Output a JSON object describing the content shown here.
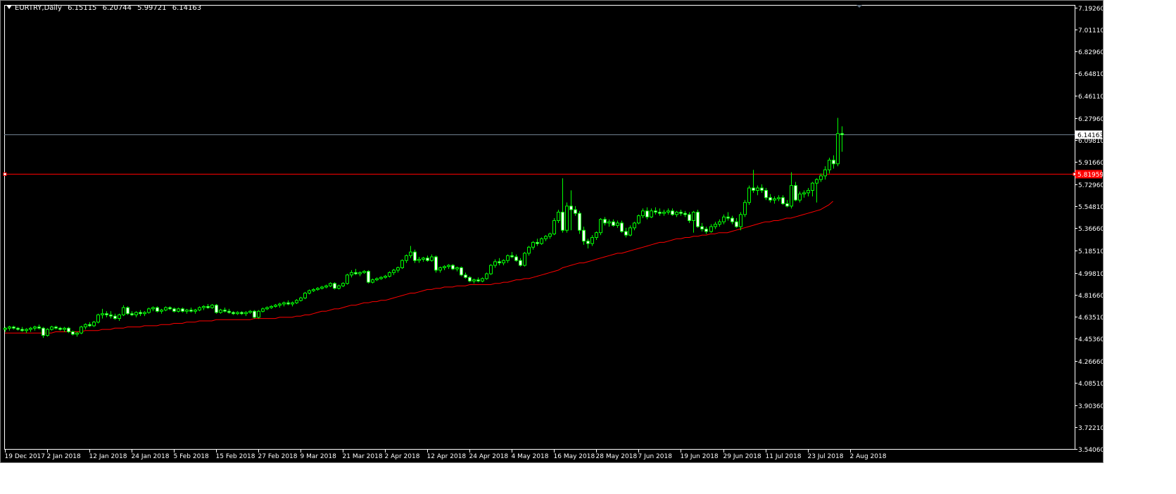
{
  "header": {
    "symbol": "EURTRY,Daily",
    "open": "6.15115",
    "high": "6.20744",
    "low": "5.99721",
    "close": "6.14163"
  },
  "colors": {
    "background": "#000000",
    "foreground": "#ffffff",
    "bull": "#00ff00",
    "bull_body": "#ffffff",
    "moving_average": "#ff0000",
    "level_line": "#ff0000",
    "bid_line": "#708090"
  },
  "bid_label": "6.14163",
  "level_label": "5.81959",
  "chart_data": {
    "type": "candlestick",
    "title": "EURTRY,Daily",
    "ylim": [
      3.5406,
      7.2144
    ],
    "yticks": [
      "7.19260",
      "7.01110",
      "6.82960",
      "6.64810",
      "6.46110",
      "6.27960",
      "6.09810",
      "5.91660",
      "5.72960",
      "5.54810",
      "5.36660",
      "5.18510",
      "4.99810",
      "4.81660",
      "4.63510",
      "4.45360",
      "4.26660",
      "4.08510",
      "3.90360",
      "3.72210",
      "3.54060"
    ],
    "xlabels": [
      "19 Dec 2017",
      "2 Jan 2018",
      "12 Jan 2018",
      "24 Jan 2018",
      "5 Feb 2018",
      "15 Feb 2018",
      "27 Feb 2018",
      "9 Mar 2018",
      "21 Mar 2018",
      "2 Apr 2018",
      "12 Apr 2018",
      "24 Apr 2018",
      "4 May 2018",
      "16 May 2018",
      "28 May 2018",
      "7 Jun 2018",
      "19 Jun 2018",
      "29 Jun 2018",
      "11 Jul 2018",
      "23 Jul 2018",
      "2 Aug 2018"
    ],
    "xlabel_bars": [
      0,
      10,
      20,
      30,
      40,
      50,
      60,
      70,
      80,
      90,
      100,
      110,
      120,
      130,
      140,
      150,
      160,
      170,
      180,
      190,
      200
    ],
    "bid": 6.14163,
    "level": 5.81959,
    "candles": [
      [
        4.53,
        4.55,
        4.51,
        4.54
      ],
      [
        4.54,
        4.56,
        4.52,
        4.55
      ],
      [
        4.55,
        4.56,
        4.53,
        4.54
      ],
      [
        4.54,
        4.55,
        4.52,
        4.53
      ],
      [
        4.53,
        4.55,
        4.51,
        4.52
      ],
      [
        4.52,
        4.54,
        4.5,
        4.53
      ],
      [
        4.53,
        4.55,
        4.51,
        4.54
      ],
      [
        4.54,
        4.56,
        4.52,
        4.55
      ],
      [
        4.55,
        4.57,
        4.53,
        4.54
      ],
      [
        4.54,
        4.55,
        4.46,
        4.48
      ],
      [
        4.48,
        4.54,
        4.47,
        4.53
      ],
      [
        4.53,
        4.56,
        4.52,
        4.55
      ],
      [
        4.55,
        4.56,
        4.53,
        4.54
      ],
      [
        4.54,
        4.55,
        4.52,
        4.53
      ],
      [
        4.53,
        4.55,
        4.51,
        4.54
      ],
      [
        4.54,
        4.55,
        4.5,
        4.51
      ],
      [
        4.51,
        4.52,
        4.48,
        4.49
      ],
      [
        4.49,
        4.51,
        4.47,
        4.5
      ],
      [
        4.5,
        4.56,
        4.49,
        4.55
      ],
      [
        4.55,
        4.58,
        4.53,
        4.57
      ],
      [
        4.57,
        4.59,
        4.55,
        4.56
      ],
      [
        4.56,
        4.6,
        4.55,
        4.59
      ],
      [
        4.59,
        4.66,
        4.58,
        4.65
      ],
      [
        4.65,
        4.7,
        4.62,
        4.66
      ],
      [
        4.66,
        4.68,
        4.63,
        4.65
      ],
      [
        4.65,
        4.68,
        4.62,
        4.64
      ],
      [
        4.64,
        4.66,
        4.61,
        4.62
      ],
      [
        4.62,
        4.66,
        4.6,
        4.65
      ],
      [
        4.65,
        4.73,
        4.64,
        4.71
      ],
      [
        4.71,
        4.72,
        4.65,
        4.66
      ],
      [
        4.66,
        4.68,
        4.64,
        4.65
      ],
      [
        4.65,
        4.68,
        4.63,
        4.67
      ],
      [
        4.67,
        4.69,
        4.64,
        4.66
      ],
      [
        4.66,
        4.68,
        4.64,
        4.67
      ],
      [
        4.67,
        4.71,
        4.66,
        4.7
      ],
      [
        4.7,
        4.72,
        4.68,
        4.71
      ],
      [
        4.71,
        4.72,
        4.67,
        4.68
      ],
      [
        4.68,
        4.7,
        4.66,
        4.69
      ],
      [
        4.69,
        4.72,
        4.68,
        4.71
      ],
      [
        4.71,
        4.72,
        4.69,
        4.7
      ],
      [
        4.7,
        4.71,
        4.67,
        4.68
      ],
      [
        4.68,
        4.71,
        4.67,
        4.7
      ],
      [
        4.7,
        4.71,
        4.67,
        4.68
      ],
      [
        4.68,
        4.7,
        4.66,
        4.69
      ],
      [
        4.69,
        4.71,
        4.67,
        4.68
      ],
      [
        4.68,
        4.7,
        4.66,
        4.69
      ],
      [
        4.69,
        4.72,
        4.68,
        4.71
      ],
      [
        4.71,
        4.73,
        4.69,
        4.72
      ],
      [
        4.72,
        4.74,
        4.7,
        4.71
      ],
      [
        4.71,
        4.74,
        4.7,
        4.73
      ],
      [
        4.73,
        4.74,
        4.66,
        4.67
      ],
      [
        4.67,
        4.7,
        4.66,
        4.69
      ],
      [
        4.69,
        4.71,
        4.67,
        4.68
      ],
      [
        4.68,
        4.7,
        4.66,
        4.67
      ],
      [
        4.67,
        4.68,
        4.65,
        4.66
      ],
      [
        4.66,
        4.68,
        4.65,
        4.67
      ],
      [
        4.67,
        4.68,
        4.65,
        4.66
      ],
      [
        4.66,
        4.68,
        4.64,
        4.67
      ],
      [
        4.67,
        4.69,
        4.66,
        4.68
      ],
      [
        4.68,
        4.69,
        4.62,
        4.63
      ],
      [
        4.63,
        4.69,
        4.62,
        4.68
      ],
      [
        4.68,
        4.71,
        4.67,
        4.7
      ],
      [
        4.7,
        4.72,
        4.69,
        4.71
      ],
      [
        4.71,
        4.73,
        4.7,
        4.72
      ],
      [
        4.72,
        4.74,
        4.71,
        4.73
      ],
      [
        4.73,
        4.75,
        4.71,
        4.74
      ],
      [
        4.74,
        4.76,
        4.72,
        4.75
      ],
      [
        4.75,
        4.77,
        4.73,
        4.74
      ],
      [
        4.74,
        4.76,
        4.72,
        4.75
      ],
      [
        4.75,
        4.78,
        4.74,
        4.77
      ],
      [
        4.77,
        4.8,
        4.76,
        4.79
      ],
      [
        4.79,
        4.84,
        4.78,
        4.83
      ],
      [
        4.83,
        4.86,
        4.82,
        4.85
      ],
      [
        4.85,
        4.87,
        4.84,
        4.86
      ],
      [
        4.86,
        4.88,
        4.85,
        4.87
      ],
      [
        4.87,
        4.89,
        4.86,
        4.88
      ],
      [
        4.88,
        4.9,
        4.87,
        4.89
      ],
      [
        4.89,
        4.92,
        4.88,
        4.91
      ],
      [
        4.91,
        4.92,
        4.86,
        4.87
      ],
      [
        4.87,
        4.9,
        4.86,
        4.89
      ],
      [
        4.89,
        4.92,
        4.88,
        4.91
      ],
      [
        4.91,
        4.99,
        4.9,
        4.98
      ],
      [
        4.98,
        5.02,
        4.96,
        5.0
      ],
      [
        5.0,
        5.03,
        4.98,
        4.99
      ],
      [
        4.99,
        5.01,
        4.97,
        5.0
      ],
      [
        5.0,
        5.02,
        4.99,
        5.01
      ],
      [
        5.01,
        5.02,
        4.91,
        4.92
      ],
      [
        4.92,
        4.95,
        4.91,
        4.94
      ],
      [
        4.94,
        4.96,
        4.93,
        4.95
      ],
      [
        4.95,
        4.97,
        4.94,
        4.96
      ],
      [
        4.96,
        4.98,
        4.95,
        4.97
      ],
      [
        4.97,
        5.01,
        4.96,
        5.0
      ],
      [
        5.0,
        5.03,
        4.98,
        5.02
      ],
      [
        5.02,
        5.05,
        5.0,
        5.04
      ],
      [
        5.04,
        5.11,
        5.03,
        5.1
      ],
      [
        5.1,
        5.15,
        5.08,
        5.14
      ],
      [
        5.14,
        5.22,
        5.12,
        5.17
      ],
      [
        5.17,
        5.19,
        5.08,
        5.1
      ],
      [
        5.1,
        5.13,
        5.08,
        5.11
      ],
      [
        5.11,
        5.13,
        5.09,
        5.12
      ],
      [
        5.12,
        5.14,
        5.09,
        5.1
      ],
      [
        5.1,
        5.15,
        5.09,
        5.13
      ],
      [
        5.13,
        5.14,
        5.0,
        5.02
      ],
      [
        5.02,
        5.05,
        5.0,
        5.04
      ],
      [
        5.04,
        5.06,
        5.02,
        5.05
      ],
      [
        5.05,
        5.07,
        5.03,
        5.06
      ],
      [
        5.06,
        5.07,
        5.02,
        5.03
      ],
      [
        5.03,
        5.05,
        5.01,
        5.04
      ],
      [
        5.04,
        5.05,
        4.97,
        4.98
      ],
      [
        4.98,
        5.0,
        4.95,
        4.96
      ],
      [
        4.96,
        4.97,
        4.92,
        4.93
      ],
      [
        4.93,
        4.95,
        4.91,
        4.94
      ],
      [
        4.94,
        4.96,
        4.92,
        4.93
      ],
      [
        4.93,
        4.96,
        4.92,
        4.95
      ],
      [
        4.95,
        5.0,
        4.94,
        4.99
      ],
      [
        4.99,
        5.07,
        4.98,
        5.06
      ],
      [
        5.06,
        5.11,
        5.04,
        5.09
      ],
      [
        5.09,
        5.12,
        5.06,
        5.08
      ],
      [
        5.08,
        5.11,
        5.06,
        5.1
      ],
      [
        5.1,
        5.15,
        5.08,
        5.14
      ],
      [
        5.14,
        5.17,
        5.12,
        5.13
      ],
      [
        5.13,
        5.15,
        5.09,
        5.1
      ],
      [
        5.1,
        5.12,
        5.05,
        5.06
      ],
      [
        5.06,
        5.17,
        5.05,
        5.16
      ],
      [
        5.16,
        5.22,
        5.14,
        5.21
      ],
      [
        5.21,
        5.26,
        5.19,
        5.25
      ],
      [
        5.25,
        5.28,
        5.22,
        5.24
      ],
      [
        5.24,
        5.29,
        5.23,
        5.28
      ],
      [
        5.28,
        5.31,
        5.26,
        5.3
      ],
      [
        5.3,
        5.33,
        5.28,
        5.32
      ],
      [
        5.32,
        5.45,
        5.31,
        5.43
      ],
      [
        5.43,
        5.52,
        5.41,
        5.5
      ],
      [
        5.5,
        5.78,
        5.33,
        5.35
      ],
      [
        5.35,
        5.58,
        5.33,
        5.55
      ],
      [
        5.55,
        5.68,
        5.35,
        5.52
      ],
      [
        5.52,
        5.55,
        5.47,
        5.49
      ],
      [
        5.49,
        5.51,
        5.32,
        5.35
      ],
      [
        5.35,
        5.38,
        5.23,
        5.26
      ],
      [
        5.26,
        5.28,
        5.2,
        5.24
      ],
      [
        5.24,
        5.31,
        5.22,
        5.29
      ],
      [
        5.29,
        5.34,
        5.27,
        5.33
      ],
      [
        5.33,
        5.45,
        5.31,
        5.44
      ],
      [
        5.44,
        5.46,
        5.39,
        5.41
      ],
      [
        5.41,
        5.44,
        5.38,
        5.42
      ],
      [
        5.42,
        5.44,
        5.38,
        5.39
      ],
      [
        5.39,
        5.43,
        5.37,
        5.41
      ],
      [
        5.41,
        5.43,
        5.33,
        5.34
      ],
      [
        5.34,
        5.37,
        5.29,
        5.31
      ],
      [
        5.31,
        5.39,
        5.3,
        5.37
      ],
      [
        5.37,
        5.42,
        5.35,
        5.41
      ],
      [
        5.41,
        5.48,
        5.4,
        5.47
      ],
      [
        5.47,
        5.53,
        5.45,
        5.51
      ],
      [
        5.51,
        5.54,
        5.44,
        5.46
      ],
      [
        5.46,
        5.53,
        5.45,
        5.51
      ],
      [
        5.51,
        5.54,
        5.48,
        5.5
      ],
      [
        5.5,
        5.53,
        5.47,
        5.49
      ],
      [
        5.49,
        5.52,
        5.47,
        5.5
      ],
      [
        5.5,
        5.53,
        5.48,
        5.51
      ],
      [
        5.51,
        5.53,
        5.47,
        5.48
      ],
      [
        5.48,
        5.51,
        5.46,
        5.5
      ],
      [
        5.5,
        5.52,
        5.47,
        5.49
      ],
      [
        5.49,
        5.51,
        5.46,
        5.48
      ],
      [
        5.48,
        5.5,
        5.41,
        5.43
      ],
      [
        5.43,
        5.51,
        5.33,
        5.5
      ],
      [
        5.5,
        5.52,
        5.37,
        5.38
      ],
      [
        5.38,
        5.41,
        5.34,
        5.36
      ],
      [
        5.36,
        5.38,
        5.32,
        5.34
      ],
      [
        5.34,
        5.4,
        5.33,
        5.38
      ],
      [
        5.38,
        5.42,
        5.36,
        5.4
      ],
      [
        5.4,
        5.44,
        5.38,
        5.42
      ],
      [
        5.42,
        5.48,
        5.4,
        5.46
      ],
      [
        5.46,
        5.5,
        5.43,
        5.45
      ],
      [
        5.45,
        5.47,
        5.4,
        5.42
      ],
      [
        5.42,
        5.45,
        5.37,
        5.38
      ],
      [
        5.38,
        5.5,
        5.35,
        5.48
      ],
      [
        5.48,
        5.6,
        5.46,
        5.58
      ],
      [
        5.58,
        5.72,
        5.56,
        5.7
      ],
      [
        5.7,
        5.85,
        5.66,
        5.68
      ],
      [
        5.68,
        5.72,
        5.64,
        5.7
      ],
      [
        5.7,
        5.73,
        5.66,
        5.68
      ],
      [
        5.68,
        5.7,
        5.6,
        5.62
      ],
      [
        5.62,
        5.65,
        5.58,
        5.6
      ],
      [
        5.6,
        5.63,
        5.57,
        5.61
      ],
      [
        5.61,
        5.64,
        5.59,
        5.62
      ],
      [
        5.62,
        5.64,
        5.56,
        5.57
      ],
      [
        5.57,
        5.6,
        5.54,
        5.55
      ],
      [
        5.55,
        5.83,
        5.53,
        5.72
      ],
      [
        5.72,
        5.75,
        5.59,
        5.6
      ],
      [
        5.6,
        5.67,
        5.58,
        5.65
      ],
      [
        5.65,
        5.68,
        5.62,
        5.66
      ],
      [
        5.66,
        5.7,
        5.63,
        5.68
      ],
      [
        5.68,
        5.75,
        5.63,
        5.74
      ],
      [
        5.74,
        5.78,
        5.58,
        5.77
      ],
      [
        5.77,
        5.82,
        5.75,
        5.8
      ],
      [
        5.8,
        5.88,
        5.77,
        5.85
      ],
      [
        5.85,
        5.95,
        5.82,
        5.93
      ],
      [
        5.93,
        5.97,
        5.86,
        5.9
      ],
      [
        5.9,
        6.28,
        5.88,
        6.15
      ],
      [
        6.15,
        6.21,
        6.0,
        6.14
      ]
    ],
    "ma": [
      4.5,
      4.5,
      4.5,
      4.5,
      4.5,
      4.5,
      4.5,
      4.5,
      4.5,
      4.5,
      4.5,
      4.5,
      4.51,
      4.51,
      4.51,
      4.51,
      4.51,
      4.51,
      4.51,
      4.52,
      4.52,
      4.52,
      4.52,
      4.53,
      4.53,
      4.53,
      4.54,
      4.54,
      4.54,
      4.55,
      4.55,
      4.55,
      4.55,
      4.56,
      4.56,
      4.56,
      4.56,
      4.57,
      4.57,
      4.57,
      4.58,
      4.58,
      4.58,
      4.59,
      4.59,
      4.59,
      4.6,
      4.6,
      4.6,
      4.6,
      4.61,
      4.61,
      4.61,
      4.61,
      4.61,
      4.61,
      4.61,
      4.61,
      4.61,
      4.62,
      4.62,
      4.62,
      4.62,
      4.62,
      4.62,
      4.63,
      4.63,
      4.63,
      4.63,
      4.64,
      4.64,
      4.65,
      4.65,
      4.66,
      4.67,
      4.68,
      4.68,
      4.69,
      4.7,
      4.7,
      4.71,
      4.72,
      4.73,
      4.73,
      4.74,
      4.75,
      4.75,
      4.76,
      4.76,
      4.77,
      4.77,
      4.78,
      4.79,
      4.8,
      4.81,
      4.82,
      4.83,
      4.83,
      4.84,
      4.85,
      4.86,
      4.86,
      4.87,
      4.87,
      4.88,
      4.88,
      4.88,
      4.89,
      4.89,
      4.89,
      4.9,
      4.9,
      4.9,
      4.9,
      4.9,
      4.9,
      4.91,
      4.91,
      4.92,
      4.92,
      4.93,
      4.94,
      4.94,
      4.95,
      4.95,
      4.96,
      4.97,
      4.98,
      4.99,
      5.0,
      5.01,
      5.02,
      5.04,
      5.05,
      5.06,
      5.07,
      5.08,
      5.08,
      5.09,
      5.1,
      5.11,
      5.12,
      5.13,
      5.14,
      5.15,
      5.16,
      5.16,
      5.17,
      5.18,
      5.19,
      5.2,
      5.21,
      5.22,
      5.23,
      5.24,
      5.25,
      5.25,
      5.26,
      5.27,
      5.28,
      5.28,
      5.29,
      5.29,
      5.3,
      5.3,
      5.31,
      5.31,
      5.32,
      5.32,
      5.33,
      5.33,
      5.33,
      5.34,
      5.35,
      5.36,
      5.37,
      5.38,
      5.39,
      5.4,
      5.41,
      5.42,
      5.42,
      5.43,
      5.43,
      5.44,
      5.45,
      5.45,
      5.46,
      5.47,
      5.48,
      5.49,
      5.5,
      5.51,
      5.52,
      5.54,
      5.56,
      5.59
    ]
  }
}
